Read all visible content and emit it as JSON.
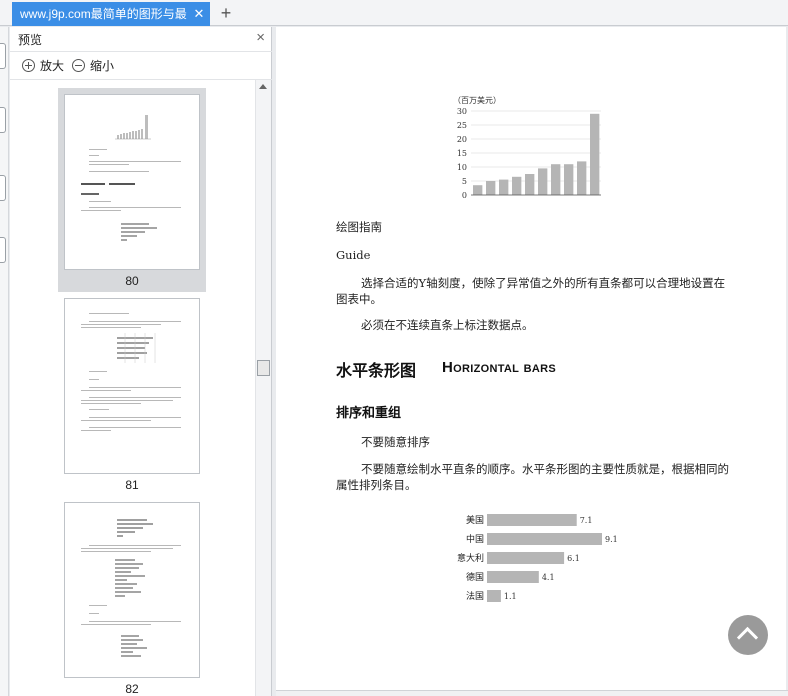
{
  "tab": {
    "title": "www.j9p.com最简单的图形与最",
    "close": "✕",
    "add": "+"
  },
  "panel": {
    "title": "预览",
    "close": "×",
    "zoom_in": "放大",
    "zoom_out": "缩小",
    "thumbnails": [
      {
        "page": "80",
        "selected": true
      },
      {
        "page": "81",
        "selected": false
      },
      {
        "page": "82",
        "selected": false
      }
    ]
  },
  "document": {
    "guide_heading": "绘图指南",
    "guide_heading_en": "Guide",
    "para1": "选择合适的Y轴刻度，使除了异常值之外的所有直条都可以合理地设置在图表中。",
    "para2": "必须在不连续直条上标注数据点。",
    "h1": "水平条形图",
    "h1_en": "Horizontal bars",
    "h2": "排序和重组",
    "sub1": "不要随意排序",
    "para3": "不要随意绘制水平直条的顺序。水平条形图的主要性质就是，根据相同的属性排列条目。"
  },
  "chart_data": [
    {
      "type": "bar",
      "ylabel": "（百万美元）",
      "yticks": [
        0,
        5,
        10,
        15,
        20,
        25,
        30
      ],
      "ylim": [
        0,
        30
      ],
      "values": [
        3.5,
        5,
        5.5,
        6.5,
        7.5,
        9.5,
        11,
        11,
        12,
        29
      ],
      "grid": true,
      "color": "#b5b5b5"
    },
    {
      "type": "bar",
      "orientation": "horizontal",
      "categories": [
        "美国",
        "中国",
        "意大利",
        "德国",
        "法国"
      ],
      "values": [
        7.1,
        9.1,
        6.1,
        4.1,
        1.1
      ],
      "value_labels": [
        "7.1",
        "9.1",
        "6.1",
        "4.1",
        "1.1"
      ],
      "color": "#b5b5b5"
    }
  ],
  "colors": {
    "accent": "#3b8ee6",
    "bar": "#b5b5b5"
  }
}
